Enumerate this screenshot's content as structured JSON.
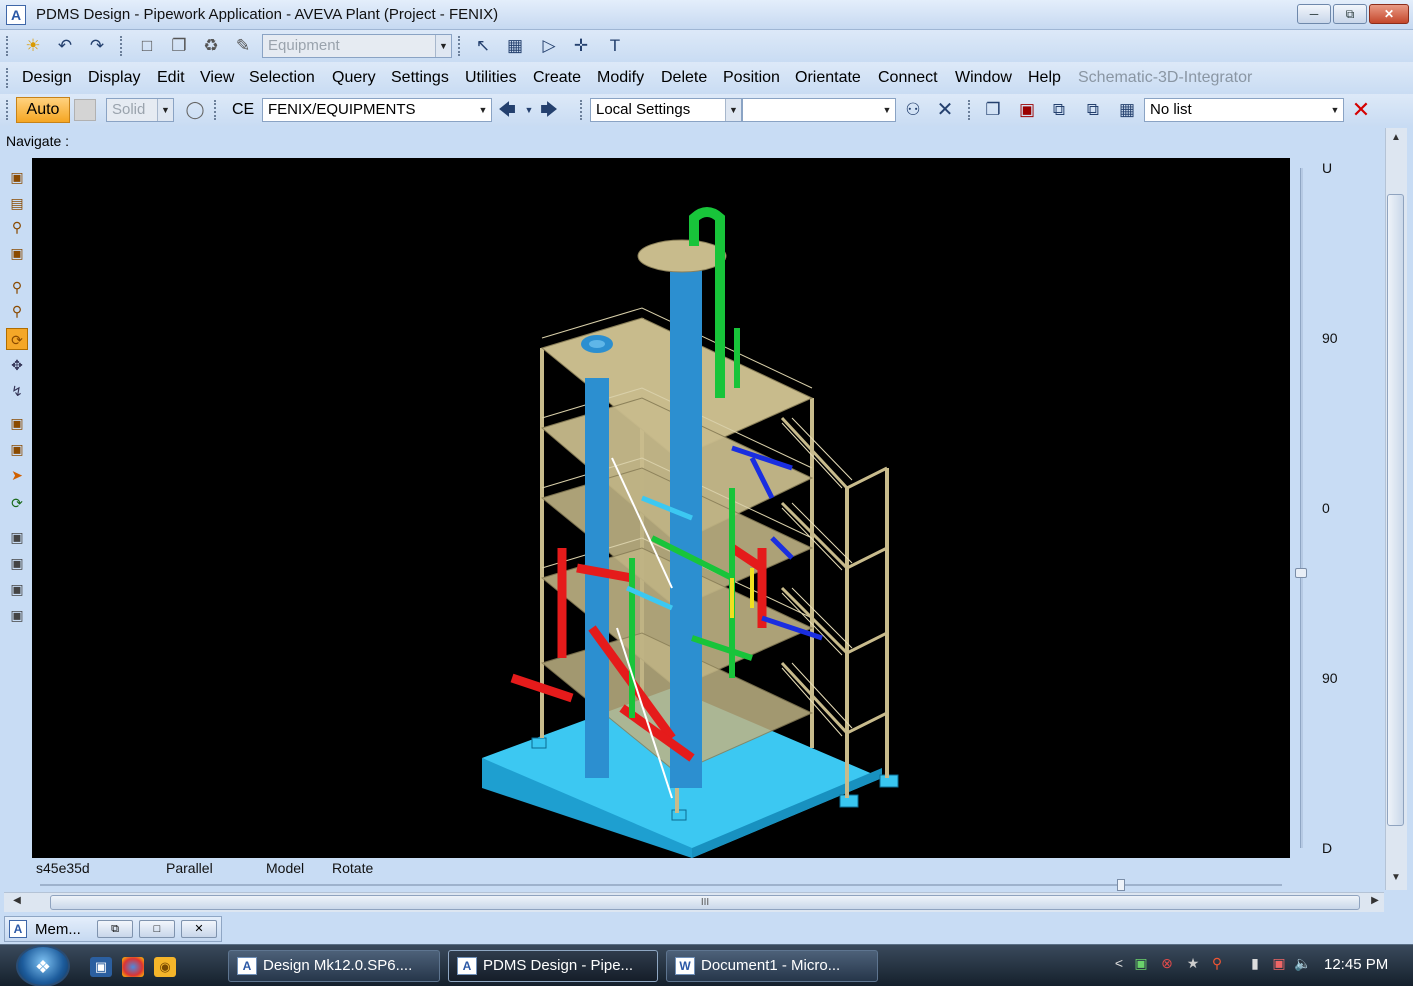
{
  "window": {
    "app_icon": "A",
    "title": "PDMS Design - Pipework Application -  AVEVA Plant (Project - FENIX)",
    "minimize_icon": "minimize-icon",
    "restore_icon": "restore-icon",
    "close_icon": "close-icon"
  },
  "toolbar_top": {
    "element_type_combo": "Equipment"
  },
  "menu": {
    "items": [
      "Design",
      "Display",
      "Edit",
      "View",
      "Selection",
      "Query",
      "Settings",
      "Utilities",
      "Create",
      "Modify",
      "Delete",
      "Position",
      "Orientate",
      "Connect",
      "Window",
      "Help"
    ],
    "disabled_item": "Schematic-3D-Integrator"
  },
  "toolbar_ce": {
    "auto_label": "Auto",
    "solid_label": "Solid",
    "ce_label": "CE",
    "ce_value": "FENIX/EQUIPMENTS",
    "settings_value": "Local Settings",
    "list_value": "No list"
  },
  "navigate_label": "Navigate :",
  "elevation_ruler": {
    "top": "U",
    "upper": "90",
    "middle": "0",
    "lower": "90",
    "bottom": "D"
  },
  "status": {
    "direction": "s45e35d",
    "projection": "Parallel",
    "mode": "Model",
    "action": "Rotate"
  },
  "hscroll_grip": "III",
  "minimized_window": {
    "title": "Mem..."
  },
  "taskbar": {
    "tasks": [
      "Design Mk12.0.SP6....",
      "PDMS Design - Pipe...",
      "Document1 - Micro..."
    ],
    "clock": "12:45 PM"
  },
  "colors": {
    "viewport_bg": "#000000",
    "steel": "#c8bb8c",
    "vessel": "#2c8fd0",
    "foundation": "#39c6f0",
    "pipe_red": "#e51b1b",
    "pipe_green": "#18c43a",
    "pipe_blue": "#1a2ee0",
    "pipe_yellow": "#f0e020"
  }
}
